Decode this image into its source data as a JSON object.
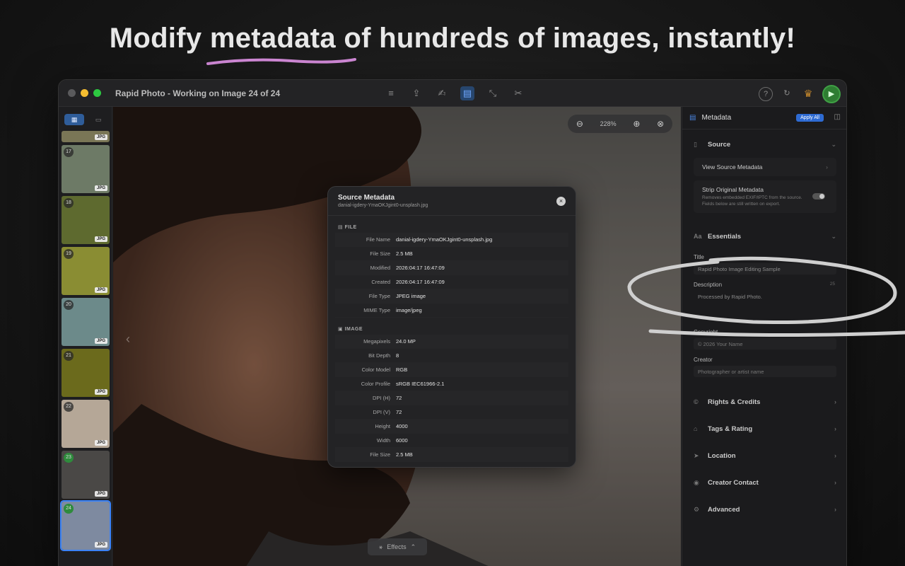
{
  "headline": {
    "before": "Modify ",
    "highlight": "metadata",
    "after": " of hundreds of images, instantly!"
  },
  "window": {
    "title": "Rapid Photo - Working on Image 24 of 24"
  },
  "sidebar": {
    "thumbnails": [
      {
        "number": "",
        "badge": "JPG",
        "color": "#7a7656"
      },
      {
        "number": "17",
        "badge": "JPG",
        "color": "#6d7a66"
      },
      {
        "number": "18",
        "badge": "JPG",
        "color": "#5e6a2f"
      },
      {
        "number": "19",
        "badge": "JPG",
        "color": "#8a8d33"
      },
      {
        "number": "20",
        "badge": "JPG",
        "color": "#6c8a8a"
      },
      {
        "number": "21",
        "badge": "JPG",
        "color": "#6b6a1c"
      },
      {
        "number": "22",
        "badge": "JPG",
        "color": "#b5a797"
      },
      {
        "number": "23",
        "badge": "JPG",
        "color": "#4a4846"
      },
      {
        "number": "24",
        "badge": "JPG",
        "color": "#7e8aa0"
      }
    ]
  },
  "viewer": {
    "zoom_level": "228%",
    "effects_label": "Effects"
  },
  "modal": {
    "title": "Source Metadata",
    "filename": "danial-igdery-YmaOKJgint0-unsplash.jpg",
    "file_section": "FILE",
    "file_rows": [
      {
        "key": "File Name",
        "value": "danial-igdery-YmaOKJgint0-unsplash.jpg"
      },
      {
        "key": "File Size",
        "value": "2.5 MB"
      },
      {
        "key": "Modified",
        "value": "2026:04:17 16:47:09"
      },
      {
        "key": "Created",
        "value": "2026:04:17 16:47:09"
      },
      {
        "key": "File Type",
        "value": "JPEG image"
      },
      {
        "key": "MIME Type",
        "value": "image/jpeg"
      }
    ],
    "image_section": "IMAGE",
    "image_rows": [
      {
        "key": "Megapixels",
        "value": "24.0 MP"
      },
      {
        "key": "Bit Depth",
        "value": "8"
      },
      {
        "key": "Color Model",
        "value": "RGB"
      },
      {
        "key": "Color Profile",
        "value": "sRGB IEC61966-2.1"
      },
      {
        "key": "DPI (H)",
        "value": "72"
      },
      {
        "key": "DPI (V)",
        "value": "72"
      },
      {
        "key": "Height",
        "value": "4000"
      },
      {
        "key": "Width",
        "value": "6000"
      },
      {
        "key": "File Size",
        "value": "2.5 MB"
      }
    ]
  },
  "panel": {
    "title": "Metadata",
    "apply_all": "Apply All",
    "source": {
      "label": "Source",
      "view_source": "View Source Metadata",
      "strip_title": "Strip Original Metadata",
      "strip_desc": "Removes embedded EXIF/IPTC from the source. Fields below are still written on export."
    },
    "essentials": {
      "label": "Essentials",
      "title_label": "Title",
      "title_value": "Rapid Photo Image Editing Sample",
      "description_label": "Description",
      "description_count": "25",
      "description_value": "Processed by Rapid Photo.",
      "copyright_label": "Copyright",
      "copyright_placeholder": "© 2026 Your Name",
      "creator_label": "Creator",
      "creator_placeholder": "Photographer or artist name"
    },
    "sections": [
      "Rights & Credits",
      "Tags & Rating",
      "Location",
      "Creator Contact",
      "Advanced"
    ]
  },
  "colors": {
    "accent": "#2e6bd3",
    "play": "#2e7d32",
    "highlight_stroke": "#d28ad8"
  }
}
